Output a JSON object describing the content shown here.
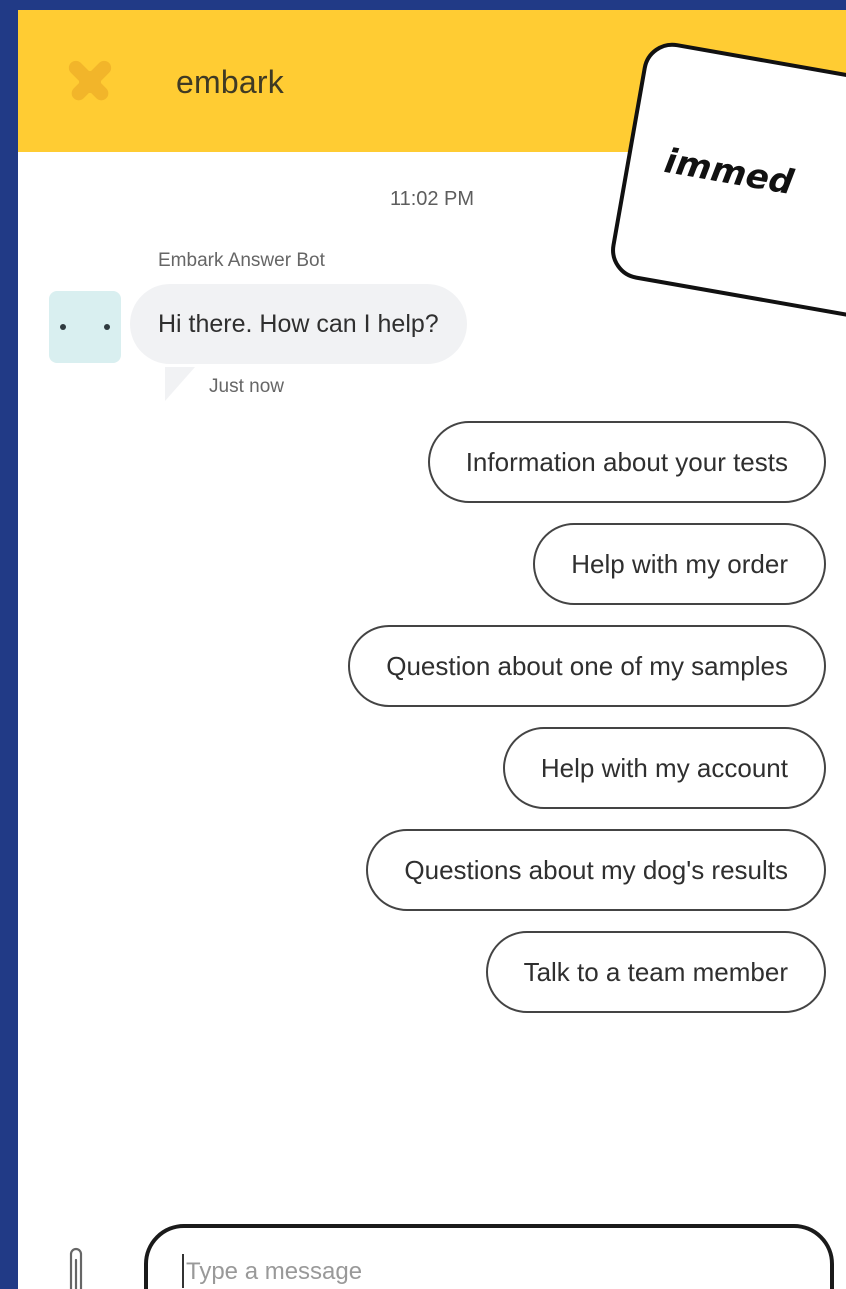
{
  "header": {
    "brand": "embark",
    "logo_icon": "embark-star-logo",
    "background": "#ffcc33"
  },
  "callout": {
    "text": "immed"
  },
  "chat": {
    "timestamp": "11:02 PM",
    "sender": "Embark Answer Bot",
    "bot_avatar_icon": "typing-dots-avatar",
    "message": "Hi there. How can I help?",
    "message_time": "Just now"
  },
  "quick_replies": [
    "Information about your tests",
    "Help with my order",
    "Question about one of my samples",
    "Help with my account",
    "Questions about my dog's results",
    "Talk to a team member"
  ],
  "composer": {
    "placeholder": "Type a message",
    "attach_icon": "paperclip-icon"
  },
  "colors": {
    "page_background": "#213a86",
    "accent_yellow": "#ffcc33",
    "avatar_bg": "#d9eff0",
    "bubble_bg": "#f1f2f4"
  }
}
